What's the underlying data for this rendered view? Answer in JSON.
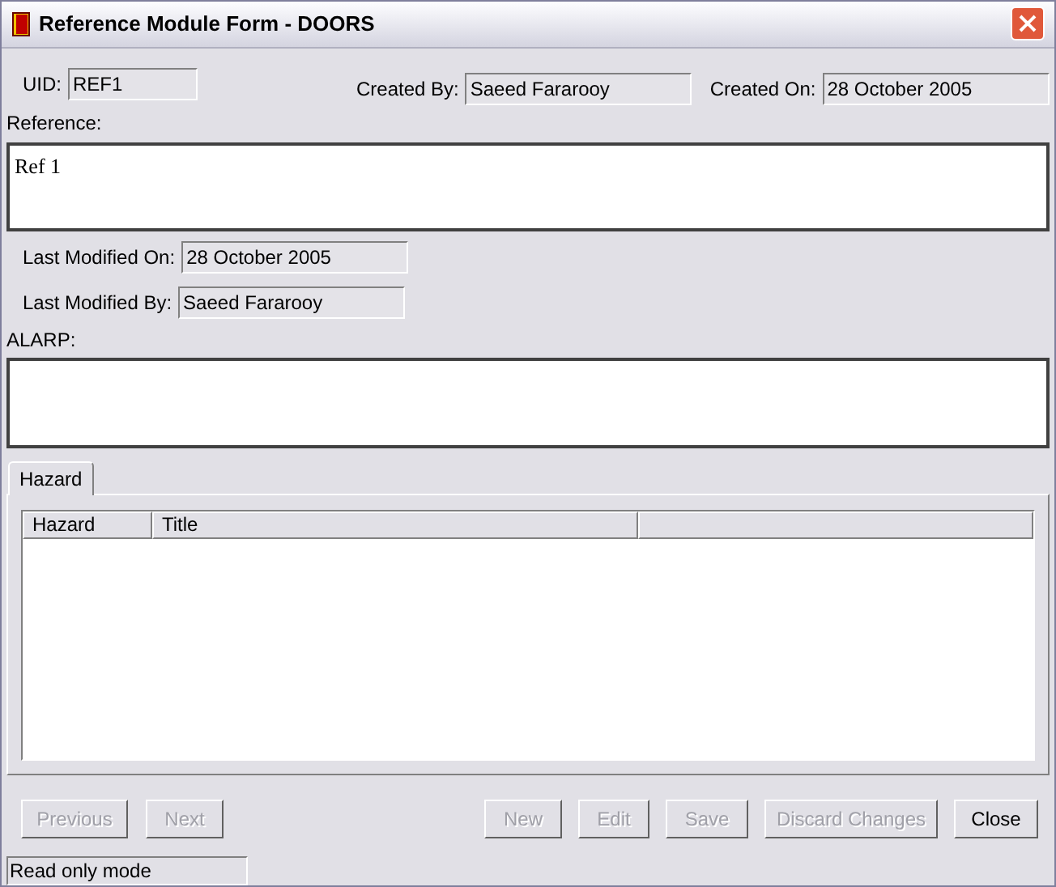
{
  "window": {
    "title": "Reference Module Form - DOORS"
  },
  "uid": {
    "label": "UID:",
    "value": "REF1"
  },
  "created_by": {
    "label": "Created By:",
    "value": "Saeed Fararooy"
  },
  "created_on": {
    "label": "Created On:",
    "value": "28 October 2005"
  },
  "reference": {
    "label": "Reference:",
    "value": "Ref 1"
  },
  "last_modified_on": {
    "label": "Last Modified On:",
    "value": "28 October 2005"
  },
  "last_modified_by": {
    "label": "Last Modified By:",
    "value": "Saeed Fararooy"
  },
  "alarp": {
    "label": "ALARP:"
  },
  "tabs": [
    {
      "label": "Hazard",
      "selected": true
    }
  ],
  "table": {
    "columns": [
      "Hazard",
      "Title"
    ]
  },
  "buttons": [
    {
      "label": "Previous",
      "disabled": true
    },
    {
      "label": "Next",
      "disabled": true
    },
    {
      "label": "New",
      "disabled": true
    },
    {
      "label": "Edit",
      "disabled": true
    },
    {
      "label": "Save",
      "disabled": true
    },
    {
      "label": "Discard Changes",
      "disabled": true
    },
    {
      "label": "Close",
      "disabled": false
    }
  ],
  "status_bar": "Read only mode"
}
